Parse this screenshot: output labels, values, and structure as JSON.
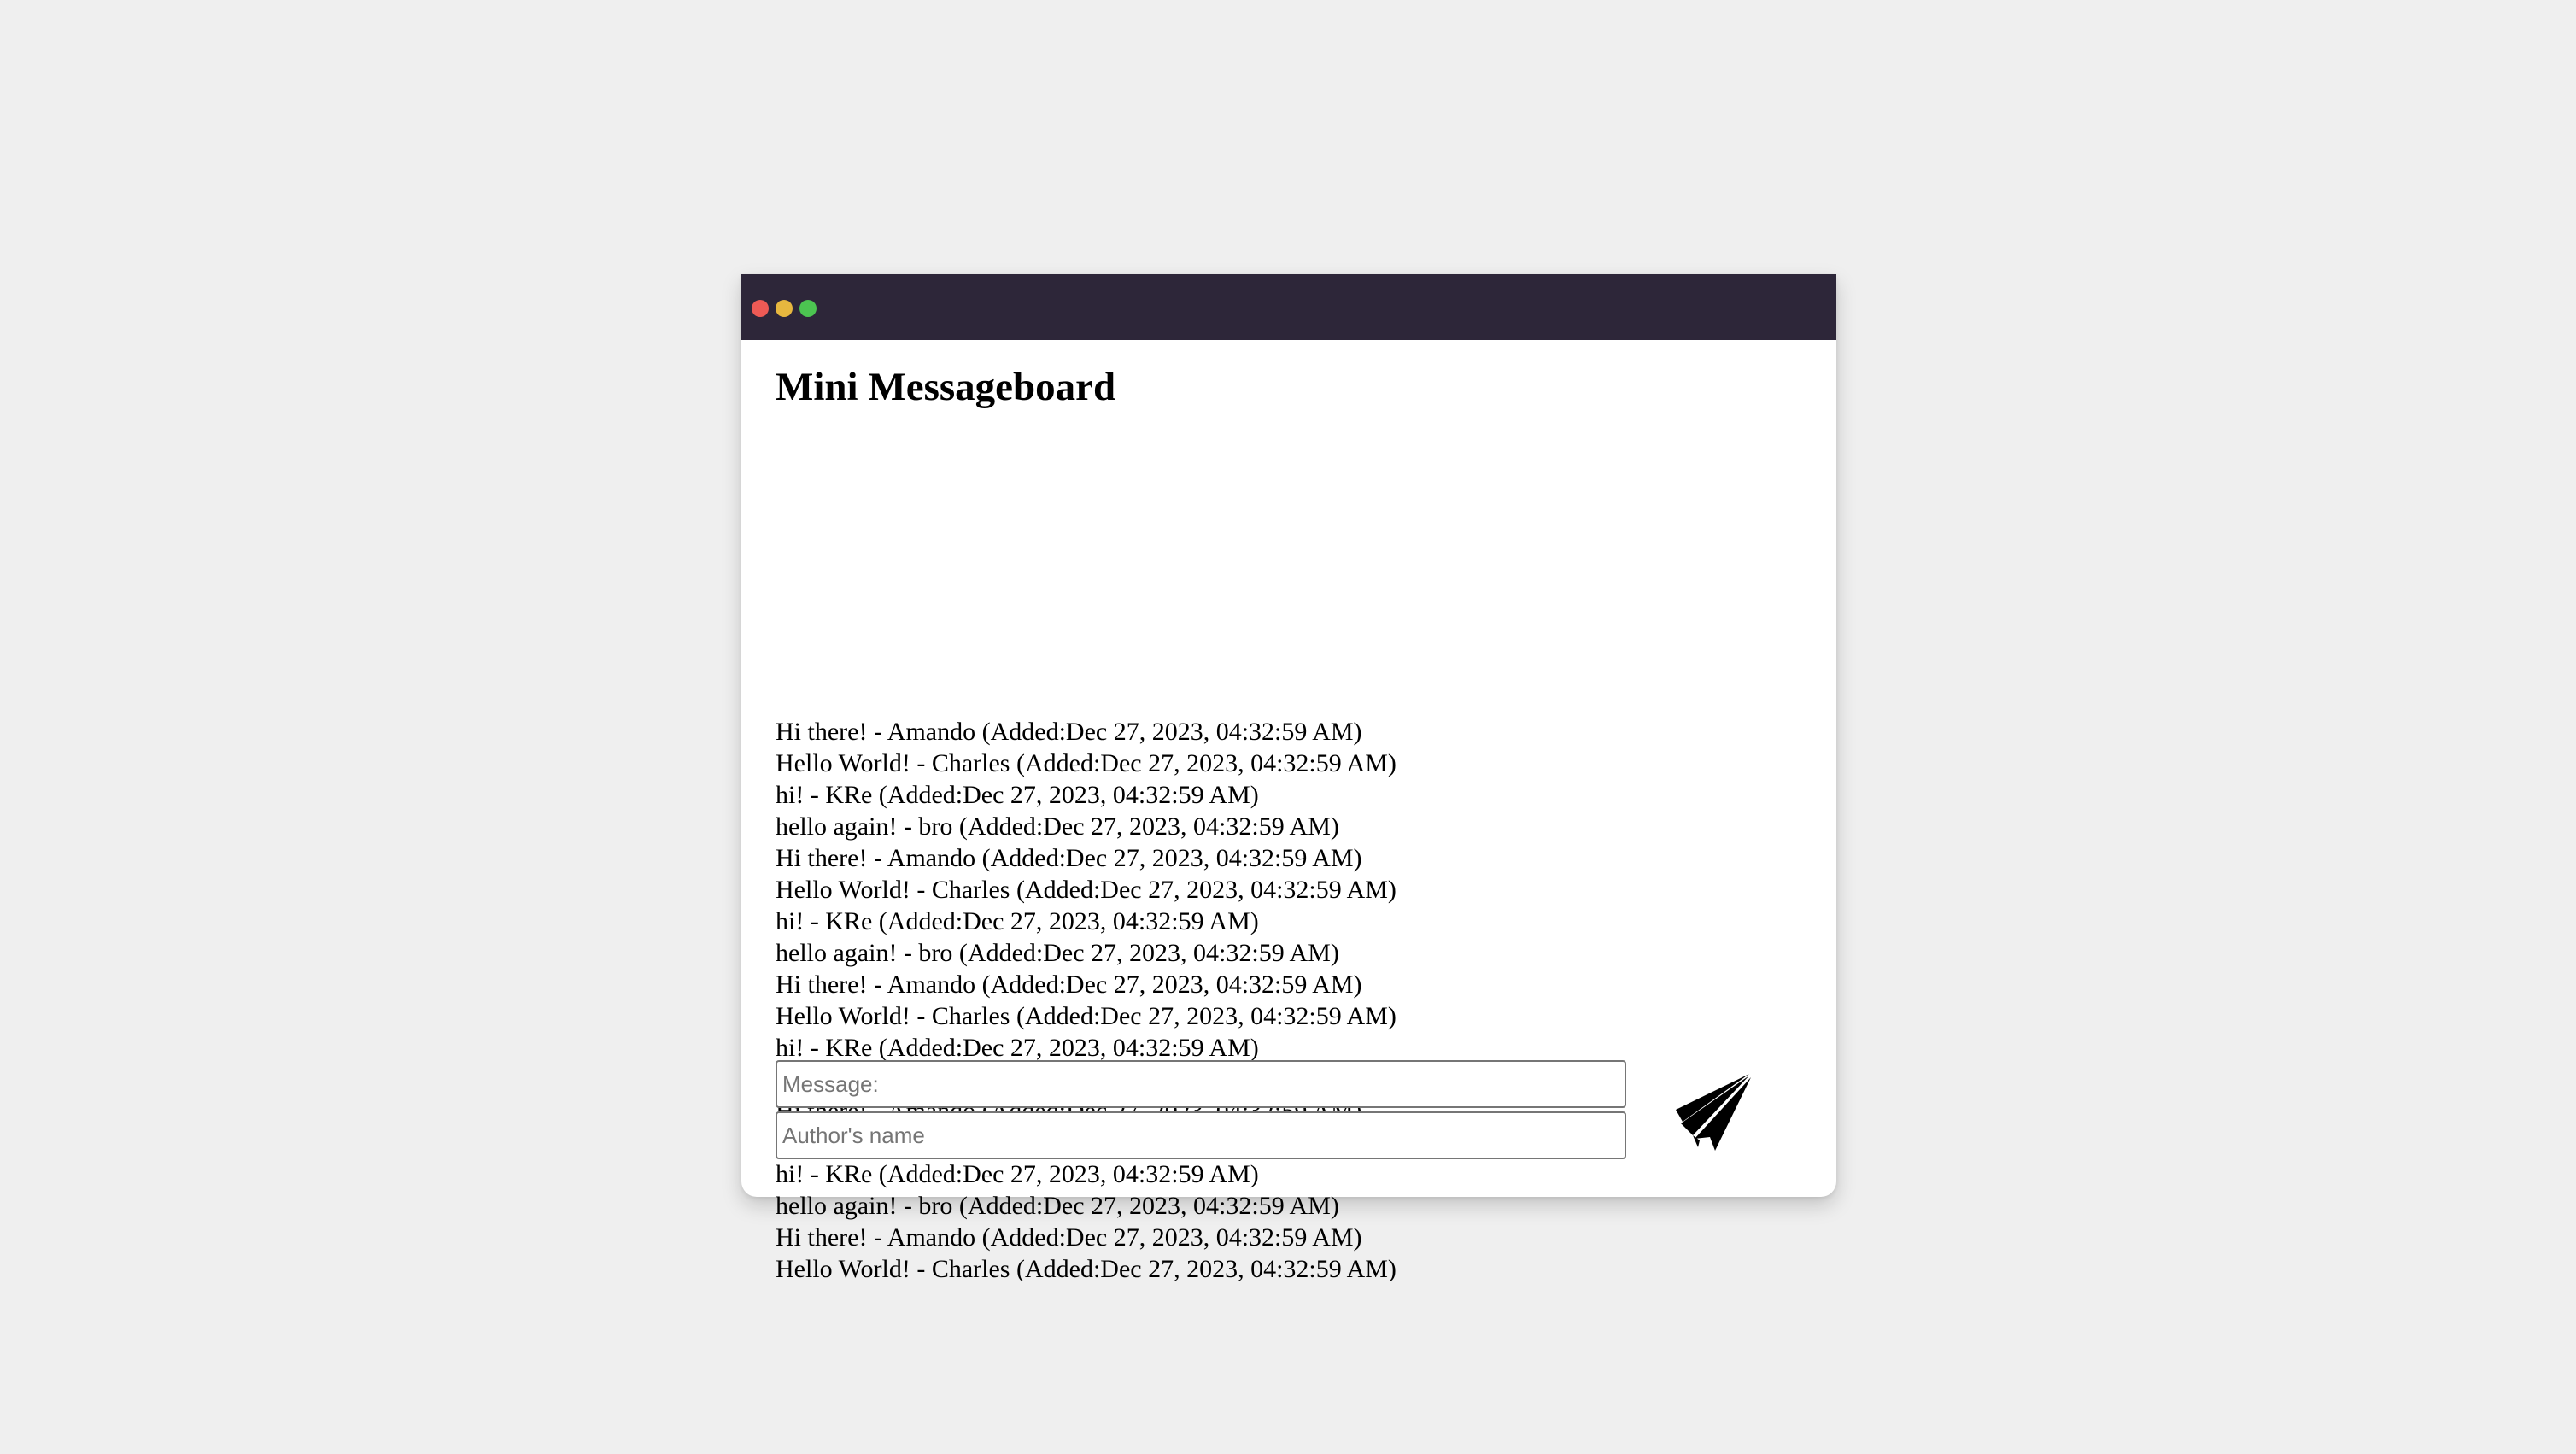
{
  "window": {
    "controls": {
      "close_color": "#ee5a55",
      "minimize_color": "#e7b73f",
      "maximize_color": "#4cc451"
    }
  },
  "page": {
    "title": "Mini Messageboard"
  },
  "messages": [
    "Hi there! - Amando (Added:Dec 27, 2023, 04:32:59 AM)",
    "Hello World! - Charles (Added:Dec 27, 2023, 04:32:59 AM)",
    "hi! - KRe (Added:Dec 27, 2023, 04:32:59 AM)",
    "hello again! - bro (Added:Dec 27, 2023, 04:32:59 AM)",
    "Hi there! - Amando (Added:Dec 27, 2023, 04:32:59 AM)",
    "Hello World! - Charles (Added:Dec 27, 2023, 04:32:59 AM)",
    "hi! - KRe (Added:Dec 27, 2023, 04:32:59 AM)",
    "hello again! - bro (Added:Dec 27, 2023, 04:32:59 AM)",
    "Hi there! - Amando (Added:Dec 27, 2023, 04:32:59 AM)",
    "Hello World! - Charles (Added:Dec 27, 2023, 04:32:59 AM)",
    "hi! - KRe (Added:Dec 27, 2023, 04:32:59 AM)",
    "hello again! - bro (Added:Dec 27, 2023, 04:32:59 AM)",
    "Hi there! - Amando (Added:Dec 27, 2023, 04:32:59 AM)",
    "Hello World! - Charles (Added:Dec 27, 2023, 04:32:59 AM)",
    "hi! - KRe (Added:Dec 27, 2023, 04:32:59 AM)",
    "hello again! - bro (Added:Dec 27, 2023, 04:32:59 AM)",
    "Hi there! - Amando (Added:Dec 27, 2023, 04:32:59 AM)",
    "Hello World! - Charles (Added:Dec 27, 2023, 04:32:59 AM)"
  ],
  "form": {
    "message_placeholder": "Message:",
    "message_value": "",
    "author_placeholder": "Author's name",
    "author_value": "",
    "send_icon": "paper-plane-icon"
  }
}
